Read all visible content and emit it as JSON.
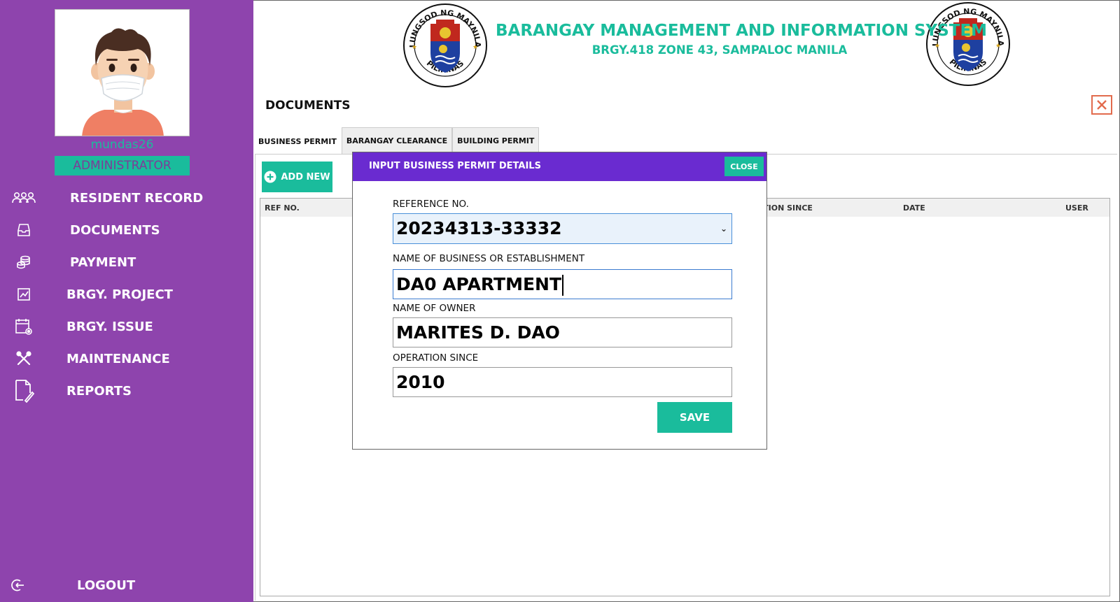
{
  "user": {
    "username": "mundas26",
    "role": "ADMINISTRATOR"
  },
  "sidebar": {
    "items": [
      {
        "label": "RESIDENT RECORD",
        "icon": "users-icon"
      },
      {
        "label": "DOCUMENTS",
        "icon": "inbox-icon"
      },
      {
        "label": "PAYMENT",
        "icon": "coins-icon"
      },
      {
        "label": "BRGY. PROJECT",
        "icon": "chart-icon"
      },
      {
        "label": "BRGY. ISSUE",
        "icon": "calendar-gear-icon"
      },
      {
        "label": "MAINTENANCE",
        "icon": "tools-icon"
      },
      {
        "label": "REPORTS",
        "icon": "document-edit-icon"
      }
    ],
    "logout_label": "LOGOUT"
  },
  "header": {
    "title": "BARANGAY MANAGEMENT AND INFORMATION SYSTEM",
    "subtitle": "BRGY.418 ZONE 43, SAMPALOC MANILA",
    "seal_top_text": "LUNGSOD NG MAYNILA",
    "seal_bottom_text": "PILIPINAS"
  },
  "main": {
    "page_title": "DOCUMENTS",
    "tabs": [
      {
        "label": "BUSINESS PERMIT",
        "active": true
      },
      {
        "label": "BARANGAY CLEARANCE",
        "active": false
      },
      {
        "label": "BUILDING PERMIT",
        "active": false
      }
    ],
    "add_new_label": "ADD NEW",
    "grid_columns": [
      "REF NO.",
      "RATION SINCE",
      "DATE",
      "USER"
    ]
  },
  "dialog": {
    "title": "INPUT BUSINESS PERMIT DETAILS",
    "close_label": "CLOSE",
    "fields": {
      "reference": {
        "label": "REFERENCE NO.",
        "value": "20234313-33332"
      },
      "business_name": {
        "label": "NAME OF BUSINESS OR ESTABLISHMENT",
        "value": "DA0 APARTMENT"
      },
      "owner": {
        "label": "NAME OF OWNER",
        "value": "MARITES D. DAO"
      },
      "operation_since": {
        "label": "OPERATION SINCE",
        "value": "2010"
      }
    },
    "save_label": "SAVE"
  },
  "colors": {
    "sidebar": "#8e44ad",
    "accent": "#1abc9c",
    "dialog_header": "#6a2bd0",
    "close_border": "#e26b4d"
  }
}
